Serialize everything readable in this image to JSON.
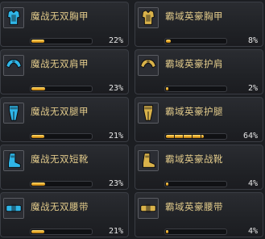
{
  "left_items": [
    {
      "name": "魔战无双胸甲",
      "percent_label": "22%",
      "progress": 0.22,
      "icon": "chest-armor-icon"
    },
    {
      "name": "魔战无双肩甲",
      "percent_label": "23%",
      "progress": 0.23,
      "icon": "shoulder-armor-icon"
    },
    {
      "name": "魔战无双腿甲",
      "percent_label": "21%",
      "progress": 0.21,
      "icon": "leg-armor-icon"
    },
    {
      "name": "魔战无双短靴",
      "percent_label": "23%",
      "progress": 0.23,
      "icon": "boots-icon"
    },
    {
      "name": "魔战无双腰带",
      "percent_label": "21%",
      "progress": 0.21,
      "icon": "belt-icon"
    }
  ],
  "right_items": [
    {
      "name": "霸域英豪胸甲",
      "percent_label": "8%",
      "progress": 0.08,
      "icon": "chest-armor-icon"
    },
    {
      "name": "霸域英豪护肩",
      "percent_label": "2%",
      "progress": 0.02,
      "icon": "shoulder-armor-icon"
    },
    {
      "name": "霸域英豪护腿",
      "percent_label": "64%",
      "progress": 0.64,
      "icon": "leg-armor-icon"
    },
    {
      "name": "霸域英豪战靴",
      "percent_label": "4%",
      "progress": 0.04,
      "icon": "boots-icon"
    },
    {
      "name": "霸域英豪腰带",
      "percent_label": "4%",
      "progress": 0.04,
      "icon": "belt-icon"
    }
  ],
  "colors": {
    "name_text": "#e0c98a",
    "progress_fill": "#e8a826",
    "left_icon_accent": "#2fb6e8",
    "right_icon_accent": "#d9b24a"
  }
}
